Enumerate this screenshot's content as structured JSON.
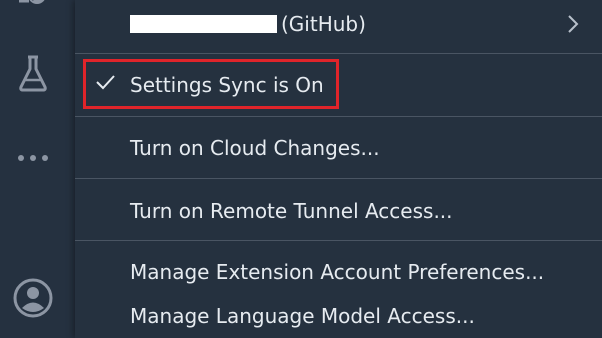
{
  "activity_bar": {
    "icons": [
      "accounts-top-icon",
      "flask-icon",
      "more-icon",
      "account-icon"
    ]
  },
  "menu": {
    "account_label": "(GitHub)",
    "account_submenu_icon": "chevron-right-icon",
    "settings_sync": "Settings Sync is On",
    "cloud_changes": "Turn on Cloud Changes...",
    "remote_tunnel": "Turn on Remote Tunnel Access...",
    "extension_prefs": "Manage Extension Account Preferences...",
    "language_model": "Manage Language Model Access..."
  },
  "colors": {
    "background": "#253140",
    "text": "#e6ebf0",
    "highlight": "#e0242a"
  }
}
